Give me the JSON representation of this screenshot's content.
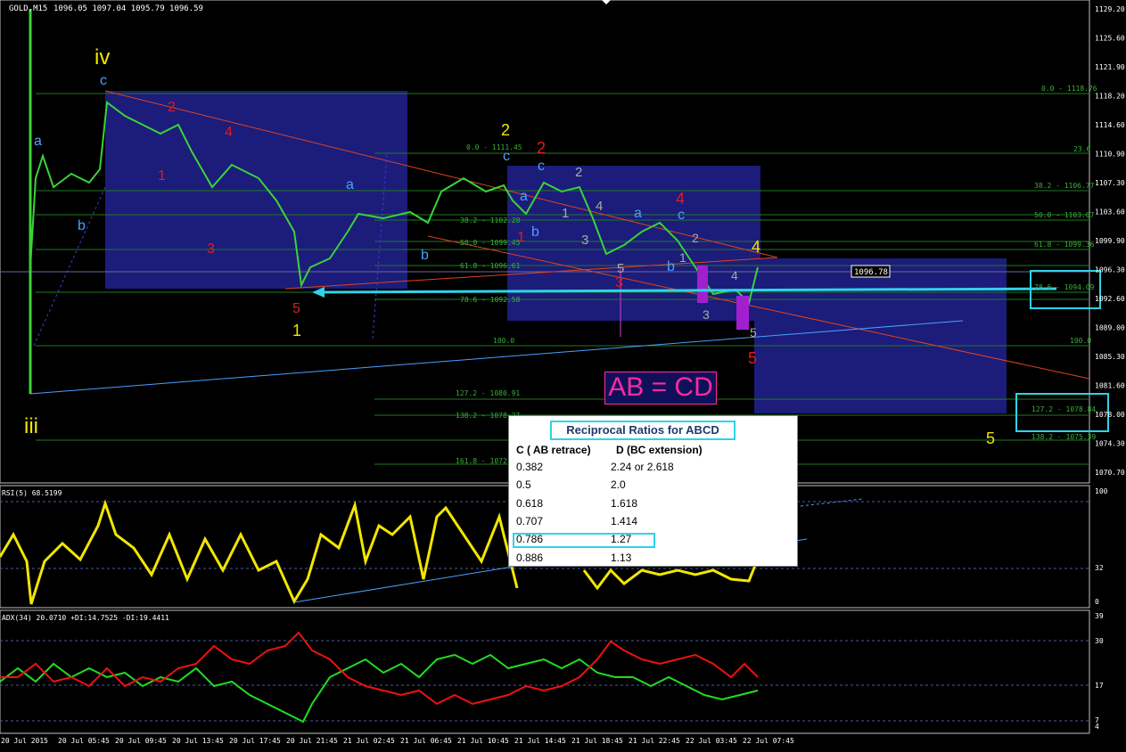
{
  "chart_header": {
    "symbol_label": "GOLD,M15",
    "ohlc_values": "1096.05 1097.04 1095.79 1096.59",
    "current_price": "1096.78"
  },
  "price_axis_ticks": [
    "1129.20",
    "1125.60",
    "1121.90",
    "1118.20",
    "1114.60",
    "1110.90",
    "1107.30",
    "1103.60",
    "1099.90",
    "1096.30",
    "1092.60",
    "1089.00",
    "1085.30",
    "1081.60",
    "1078.00",
    "1074.30",
    "1070.70"
  ],
  "time_axis_ticks": [
    "20 Jul 2015",
    "20 Jul 05:45",
    "20 Jul 09:45",
    "20 Jul 13:45",
    "20 Jul 17:45",
    "20 Jul 21:45",
    "21 Jul 02:45",
    "21 Jul 06:45",
    "21 Jul 10:45",
    "21 Jul 14:45",
    "21 Jul 18:45",
    "21 Jul 22:45",
    "22 Jul 03:45",
    "22 Jul 07:45"
  ],
  "fib_levels_left": [
    "0.0 - 1111.45",
    "38.2 - 1102.28",
    "50.0 - 1099.45",
    "61.8 - 1096.61",
    "78.6 - 1092.58",
    "100.0",
    "127.2 - 1080.91",
    "138.2 - 1078.27",
    "161.8 - 1072.6"
  ],
  "fib_levels_right": [
    "0.0 - 1118.76",
    "23.6",
    "38.2 - 1106.77",
    "50.0 - 1103.07",
    "61.8 - 1099.36",
    "78.6 - 1094.09",
    "100.0",
    "127.2 - 1078.84",
    "138.2 - 1075.39"
  ],
  "wave_labels": {
    "iii": "iii",
    "iv": "iv",
    "c": "c",
    "a": "a",
    "b": "b",
    "w1": "1",
    "w2": "2",
    "w3": "3",
    "w4": "4",
    "w5": "5"
  },
  "pattern_label": "AB = CD",
  "rsi_panel": {
    "label": "RSI(5) 68.5199",
    "ticks": [
      "100",
      "32",
      "0"
    ]
  },
  "adx_panel": {
    "label": "ADX(34) 20.0710 +DI:14.7525 -DI:19.4411",
    "ticks": [
      "39",
      "30",
      "17",
      "7",
      "4"
    ]
  },
  "ratio_table": {
    "title": "Reciprocal Ratios for ABCD",
    "col1_header": "C ( AB retrace)",
    "col2_header": "D (BC extension)",
    "rows": [
      [
        "0.382",
        "2.24 or 2.618"
      ],
      [
        "0.5",
        "2.0"
      ],
      [
        "0.618",
        "1.618"
      ],
      [
        "0.707",
        "1.414"
      ],
      [
        "0.786",
        "1.27"
      ],
      [
        "0.886",
        "1.13"
      ]
    ]
  },
  "colors": {
    "bull_candle": "#39d339",
    "fib_line": "#1f7a1f",
    "box_fill": "#1c1c7a",
    "rsi_line": "#f2e600",
    "adx_plus": "#22dd22",
    "adx_minus": "#ee1111",
    "highlight": "#2fd3e6"
  },
  "chart_data": {
    "type": "line",
    "title": "GOLD,M15",
    "ylim": [
      1068.9,
      1131.0
    ],
    "x": [
      "20 Jul 2015",
      "20 Jul 05:45",
      "20 Jul 09:45",
      "20 Jul 13:45",
      "20 Jul 17:45",
      "20 Jul 21:45",
      "21 Jul 02:45",
      "21 Jul 06:45",
      "21 Jul 10:45",
      "21 Jul 14:45",
      "21 Jul 18:45",
      "21 Jul 22:45",
      "22 Jul 03:45",
      "22 Jul 07:45"
    ],
    "series": [
      {
        "name": "GOLD,M15",
        "values": [
          1081.0,
          1108.0,
          1118.0,
          1112.0,
          1107.0,
          1093.0,
          1102.0,
          1101.0,
          1107.0,
          1106.0,
          1100.0,
          1102.0,
          1094.0,
          1096.6
        ]
      }
    ]
  }
}
